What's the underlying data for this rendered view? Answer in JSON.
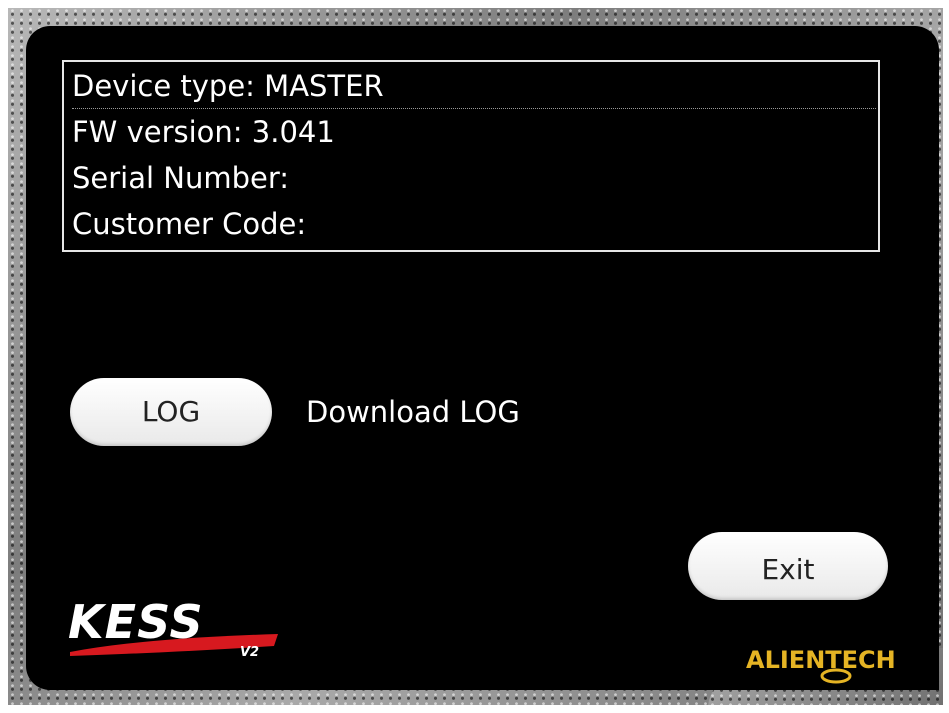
{
  "device_info": {
    "device_type": "Device type: MASTER",
    "fw_version": "FW version: 3.041",
    "serial_number": "Serial Number:",
    "customer_code": "Customer Code:"
  },
  "log_button": {
    "label": "LOG",
    "description": "Download LOG"
  },
  "exit_button": {
    "label": "Exit"
  },
  "branding": {
    "product_logo_text": "KESS",
    "product_version_text": "V2",
    "company_logo_text": "ALIENTECH"
  },
  "colors": {
    "panel_background": "#000000",
    "text": "#ffffff",
    "button_background": "#f2f2f2",
    "brand_red": "#d7191f",
    "brand_gold": "#e5b424"
  }
}
